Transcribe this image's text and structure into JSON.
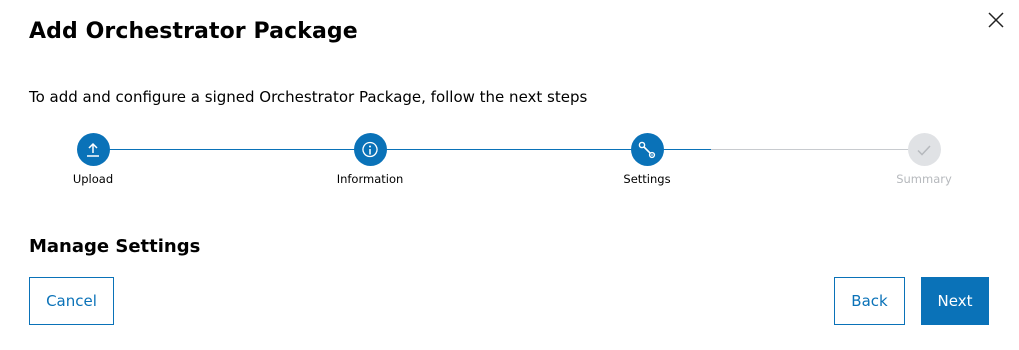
{
  "dialog": {
    "title": "Add Orchestrator Package",
    "description": "To add and configure a signed Orchestrator Package, follow the next steps",
    "close_icon": "close-icon"
  },
  "stepper": {
    "active_color": "#0a72b8",
    "inactive_color": "#e0e2e5",
    "current_step": 3,
    "steps": [
      {
        "label": "Upload",
        "icon": "upload-icon",
        "state": "completed"
      },
      {
        "label": "Information",
        "icon": "info-icon",
        "state": "completed"
      },
      {
        "label": "Settings",
        "icon": "wrench-icon",
        "state": "current"
      },
      {
        "label": "Summary",
        "icon": "checkmark-icon",
        "state": "pending"
      }
    ]
  },
  "section": {
    "title": "Manage Settings"
  },
  "footer": {
    "cancel_label": "Cancel",
    "back_label": "Back",
    "next_label": "Next"
  }
}
